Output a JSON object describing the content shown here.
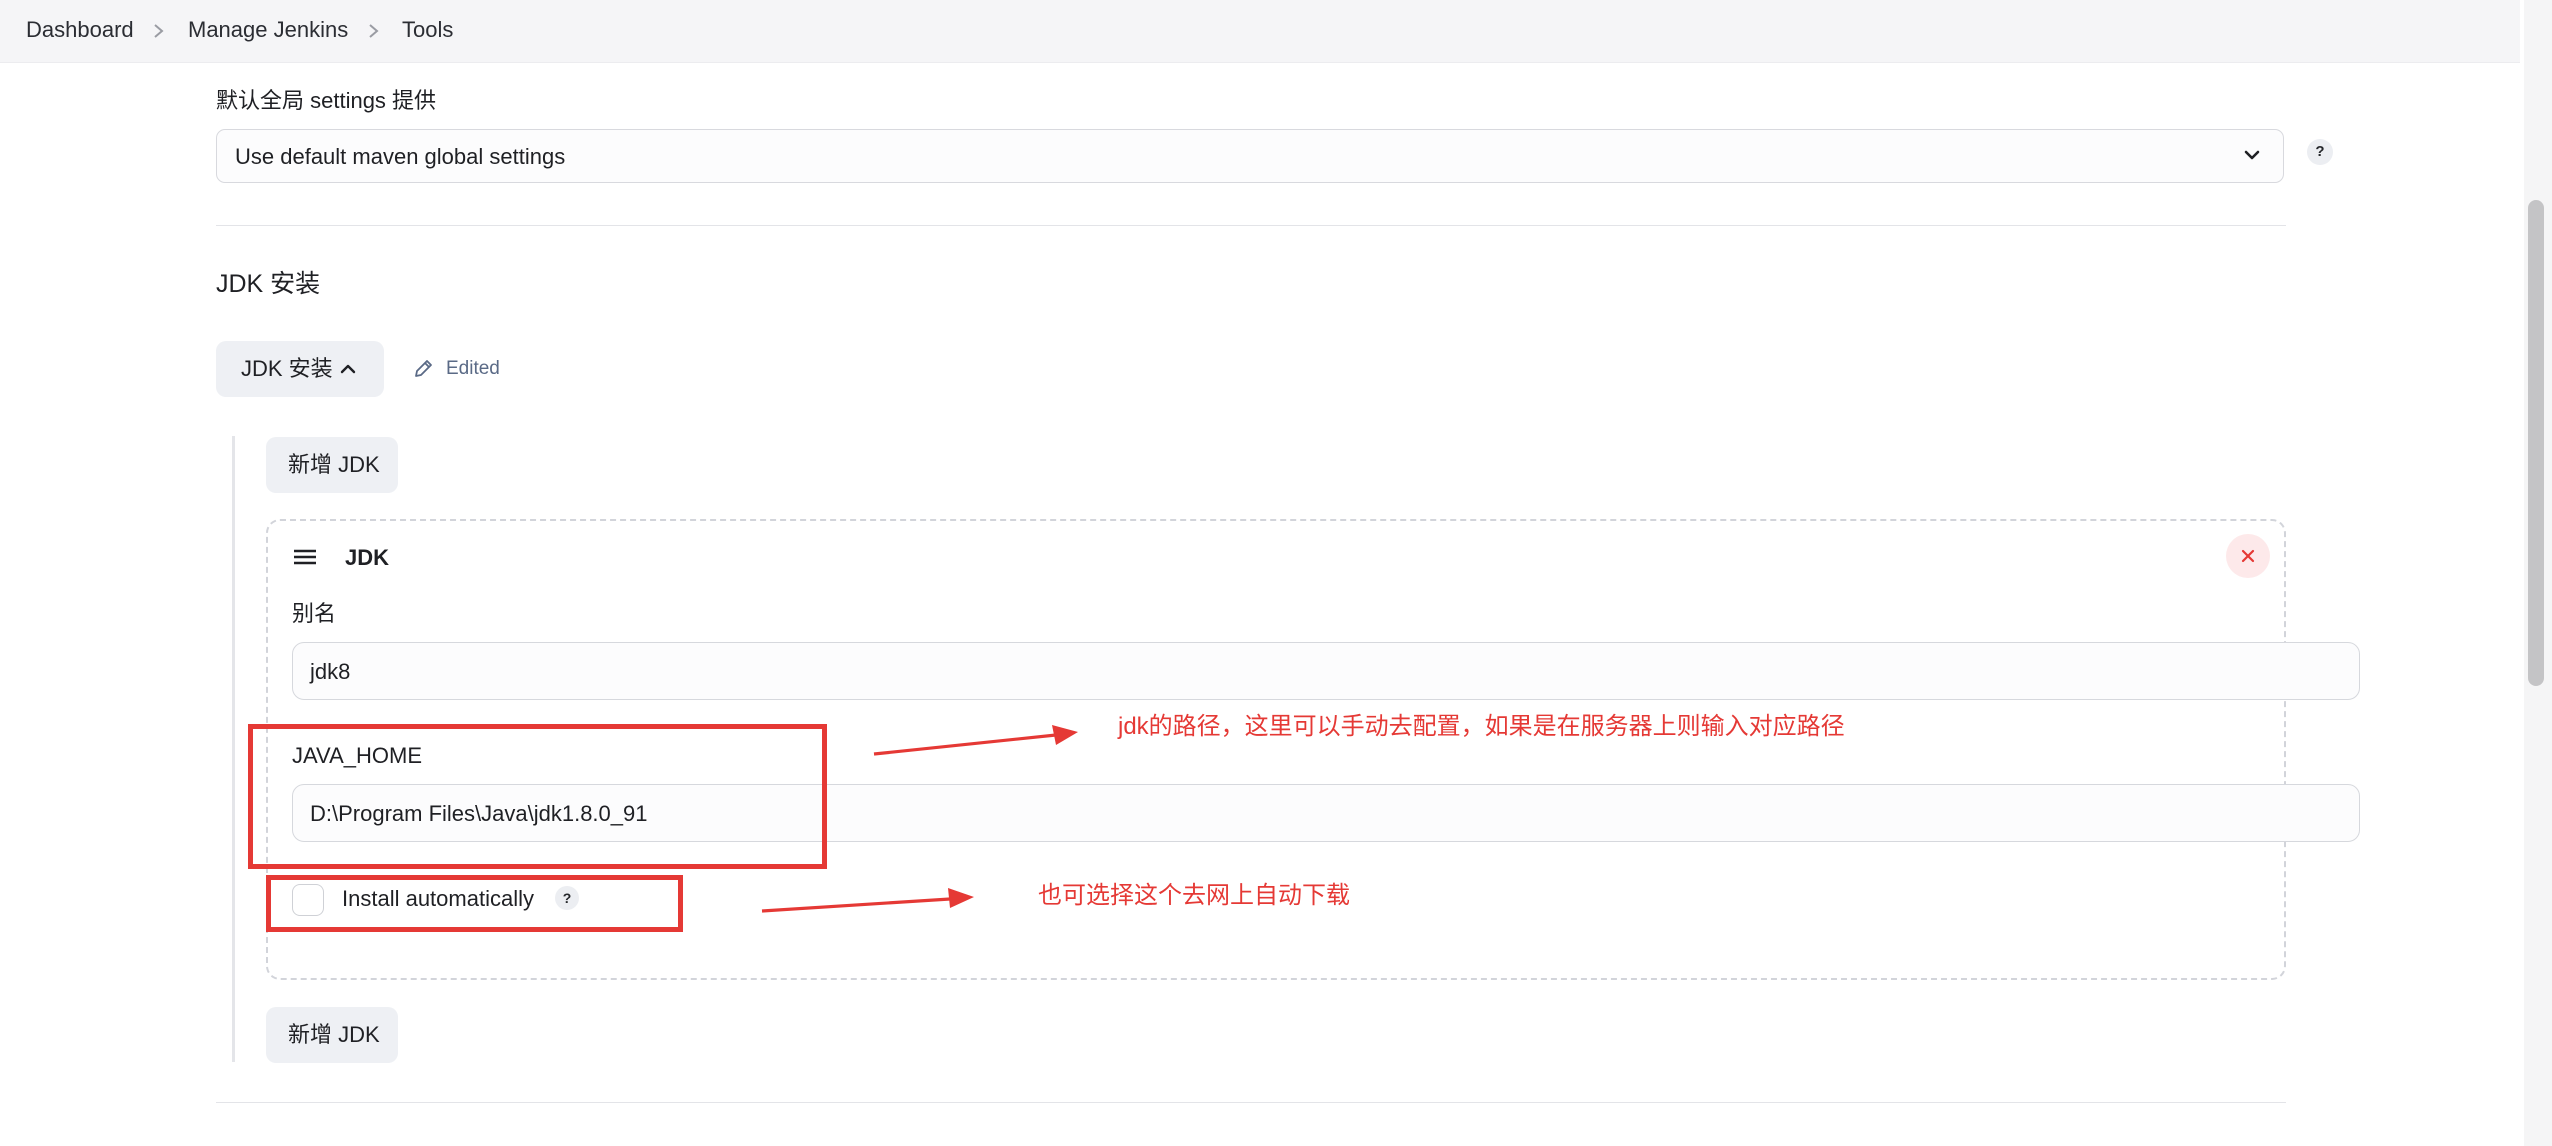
{
  "breadcrumb": {
    "items": [
      "Dashboard",
      "Manage Jenkins",
      "Tools"
    ],
    "separator": ">"
  },
  "maven_settings": {
    "label": "默认全局 settings 提供",
    "selected_value": "Use default maven global settings",
    "help": "?"
  },
  "jdk_section": {
    "title": "JDK 安装",
    "toggle_label": "JDK 安装",
    "edited_label": "Edited",
    "add_button_label": "新增 JDK",
    "card": {
      "title": "JDK",
      "alias_label": "别名",
      "alias_value": "jdk8",
      "java_home_label": "JAVA_HOME",
      "java_home_value": "D:\\Program Files\\Java\\jdk1.8.0_91",
      "install_auto_label": "Install automatically",
      "install_auto_checked": false,
      "install_help": "?"
    }
  },
  "annotations": {
    "path_note": "jdk的路径，这里可以手动去配置，如果是在服务器上则输入对应路径",
    "auto_note": "也可选择这个去网上自动下载",
    "color": "#e53935"
  },
  "colors": {
    "accent_red": "#e53935",
    "edited_blue": "#5a6a86",
    "button_bg": "#eef0f4"
  }
}
